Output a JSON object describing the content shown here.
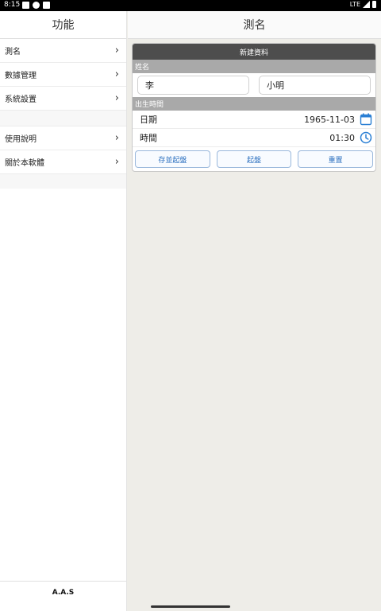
{
  "status_bar": {
    "time": "8:15",
    "network": "LTE"
  },
  "sidebar": {
    "title": "功能",
    "items": [
      {
        "label": "測名"
      },
      {
        "label": "數據管理"
      },
      {
        "label": "系統設置"
      },
      {
        "label": "使用說明"
      },
      {
        "label": "關於本軟體"
      }
    ],
    "footer": "A.A.S"
  },
  "main": {
    "title": "測名",
    "form": {
      "title": "新建資料",
      "name_section": "姓名",
      "surname": "李",
      "given_name": "小明",
      "birth_section": "出生時間",
      "date_label": "日期",
      "date_value": "1965-11-03",
      "time_label": "時間",
      "time_value": "01:30",
      "buttons": {
        "save": "存並起盤",
        "start": "起盤",
        "reset": "重置"
      }
    }
  },
  "icons": {
    "chevron": "chevron-right-icon",
    "date": "calendar-icon",
    "time": "clock-icon"
  },
  "colors": {
    "accent": "#2a7fd4",
    "title_bar": "#4d4d4d",
    "section_bar": "#a9a9a9"
  }
}
